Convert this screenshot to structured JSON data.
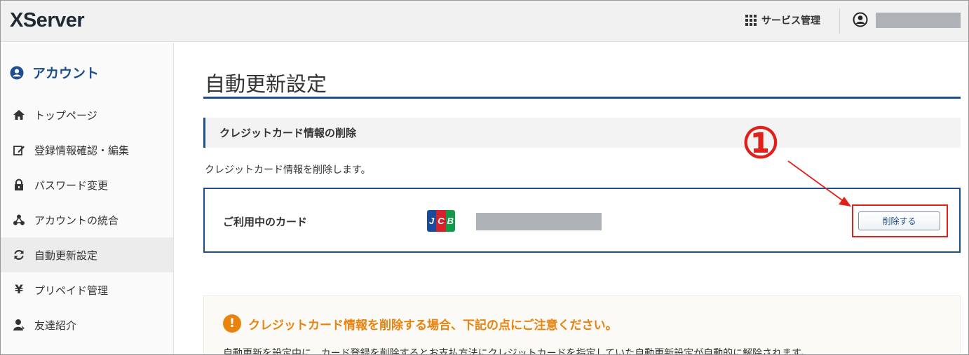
{
  "header": {
    "logo": "XServer",
    "service_menu_label": "サービス管理",
    "icons": {
      "service": "grid-icon",
      "user": "user-circle-icon"
    }
  },
  "sidebar": {
    "title": "アカウント",
    "title_icon": "user-circle-icon",
    "items": [
      {
        "label": "トップページ",
        "icon": "home-icon"
      },
      {
        "label": "登録情報確認・編集",
        "icon": "edit-icon"
      },
      {
        "label": "パスワード変更",
        "icon": "lock-icon"
      },
      {
        "label": "アカウントの統合",
        "icon": "share-nodes-icon"
      },
      {
        "label": "自動更新設定",
        "icon": "refresh-icon",
        "active": true
      },
      {
        "label": "プリペイド管理",
        "icon": "yen-icon"
      },
      {
        "label": "友達紹介",
        "icon": "person-icon"
      }
    ]
  },
  "main": {
    "page_title": "自動更新設定",
    "section_title": "クレジットカード情報の削除",
    "description": "クレジットカード情報を削除します。",
    "card": {
      "label": "ご利用中のカード",
      "brand": "JCB",
      "brand_icon": "jcb-logo-icon",
      "delete_button": "削除する"
    },
    "notice": {
      "title": "クレジットカード情報を削除する場合、下記の点にご注意ください。",
      "icon": "warning-icon",
      "body": "自動更新を設定中に、カード登録を削除するとお支払方法にクレジットカードを指定していた自動更新設定が自動的に解除されます。"
    }
  },
  "annotation": {
    "marker": "①",
    "color": "#e0201a"
  },
  "colors": {
    "accent": "#1e4f8c",
    "warning": "#e8830f",
    "highlight": "#e0201a"
  }
}
